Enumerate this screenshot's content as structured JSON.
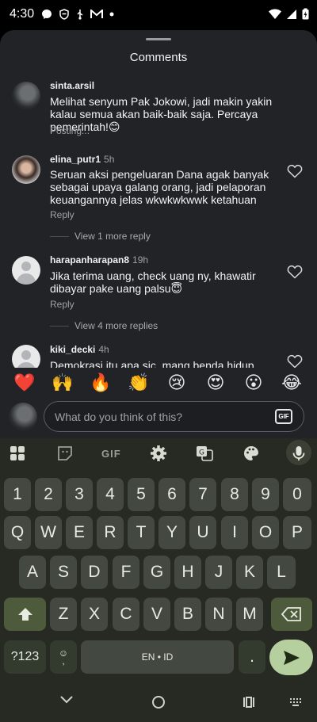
{
  "status": {
    "time": "4:30",
    "notif_icons": [
      "messenger-icon",
      "vpn-icon",
      "usb-icon",
      "gmail-icon",
      "dot-icon"
    ],
    "right_icons": [
      "wifi-icon",
      "signal-icon",
      "battery-icon"
    ]
  },
  "sheet": {
    "title": "Comments",
    "comments": [
      {
        "user": "sinta.arsil",
        "time": "",
        "text": "Melihat senyum Pak Jokowi, jadi makin yakin kalau semua akan baik-baik saja. Percaya pemerintah!😊",
        "meta": "Posting...",
        "view_more": ""
      },
      {
        "user": "elina_putr1",
        "time": "5h",
        "text": "Seruan aksi pengeluaran Dana agak banyak sebagai upaya galang orang, jadi pelaporan keuangannya jelas wkwkwkwwk ketahuan",
        "meta": "Reply",
        "view_more": "View 1 more reply"
      },
      {
        "user": "harapanharapan8",
        "time": "19h",
        "text": "Jika terima uang, check uang ny, khawatir dibayar pake uang palsu😇",
        "meta": "Reply",
        "view_more": "View 4 more replies"
      },
      {
        "user": "kiki_decki",
        "time": "4h",
        "text": "Demokrasi itu apa sic, mang benda hidup",
        "meta": "",
        "view_more": ""
      }
    ],
    "emojis": [
      "❤️",
      "🙌",
      "🔥",
      "👏",
      "😢",
      "😍",
      "😮",
      "😂"
    ],
    "input_placeholder": "What do you think of this?",
    "gif_label": "GIF"
  },
  "keyboard": {
    "toolbar_gif": "GIF",
    "row_numbers": [
      "1",
      "2",
      "3",
      "4",
      "5",
      "6",
      "7",
      "8",
      "9",
      "0"
    ],
    "row1": [
      "Q",
      "W",
      "E",
      "R",
      "T",
      "Y",
      "U",
      "I",
      "O",
      "P"
    ],
    "row2": [
      "A",
      "S",
      "D",
      "F",
      "G",
      "H",
      "J",
      "K",
      "L"
    ],
    "row3": [
      "Z",
      "X",
      "C",
      "V",
      "B",
      "N",
      "M"
    ],
    "symbols": "?123",
    "space": "EN • ID",
    "period": ".",
    "emoji_comma": ","
  },
  "nav": {
    "icons": [
      "back-chevron-icon",
      "home-circle-icon",
      "recents-icon",
      "keyboard-switch-icon"
    ]
  }
}
